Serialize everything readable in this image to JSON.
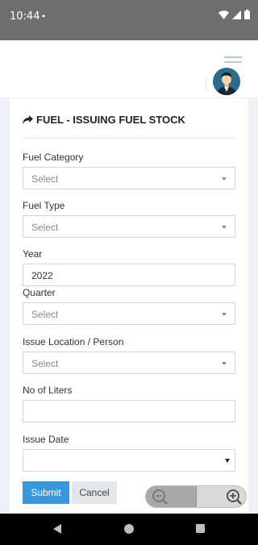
{
  "status_bar": {
    "time": "10:44",
    "dot": "•"
  },
  "page": {
    "title": "FUEL - ISSUING FUEL STOCK"
  },
  "form": {
    "fuel_category": {
      "label": "Fuel Category",
      "value": "Select"
    },
    "fuel_type": {
      "label": "Fuel Type",
      "value": "Select"
    },
    "year": {
      "label": "Year",
      "value": "2022"
    },
    "quarter": {
      "label": "Quarter",
      "value": "Select"
    },
    "issue_location": {
      "label": "Issue Location / Person",
      "value": "Select"
    },
    "no_of_liters": {
      "label": "No of Liters",
      "value": ""
    },
    "issue_date": {
      "label": "Issue Date",
      "value": ""
    }
  },
  "buttons": {
    "submit": "Submit",
    "cancel": "Cancel"
  },
  "colors": {
    "primary": "#3a97d9",
    "statusbar": "#6e6e6e",
    "page_bg": "#eef1f7"
  },
  "icons": [
    "wifi-icon",
    "signal-icon",
    "battery-icon",
    "menu-icon",
    "avatar",
    "share-arrow-icon",
    "zoom-out-icon",
    "zoom-in-icon",
    "back-nav-icon",
    "home-nav-icon",
    "recents-nav-icon"
  ]
}
